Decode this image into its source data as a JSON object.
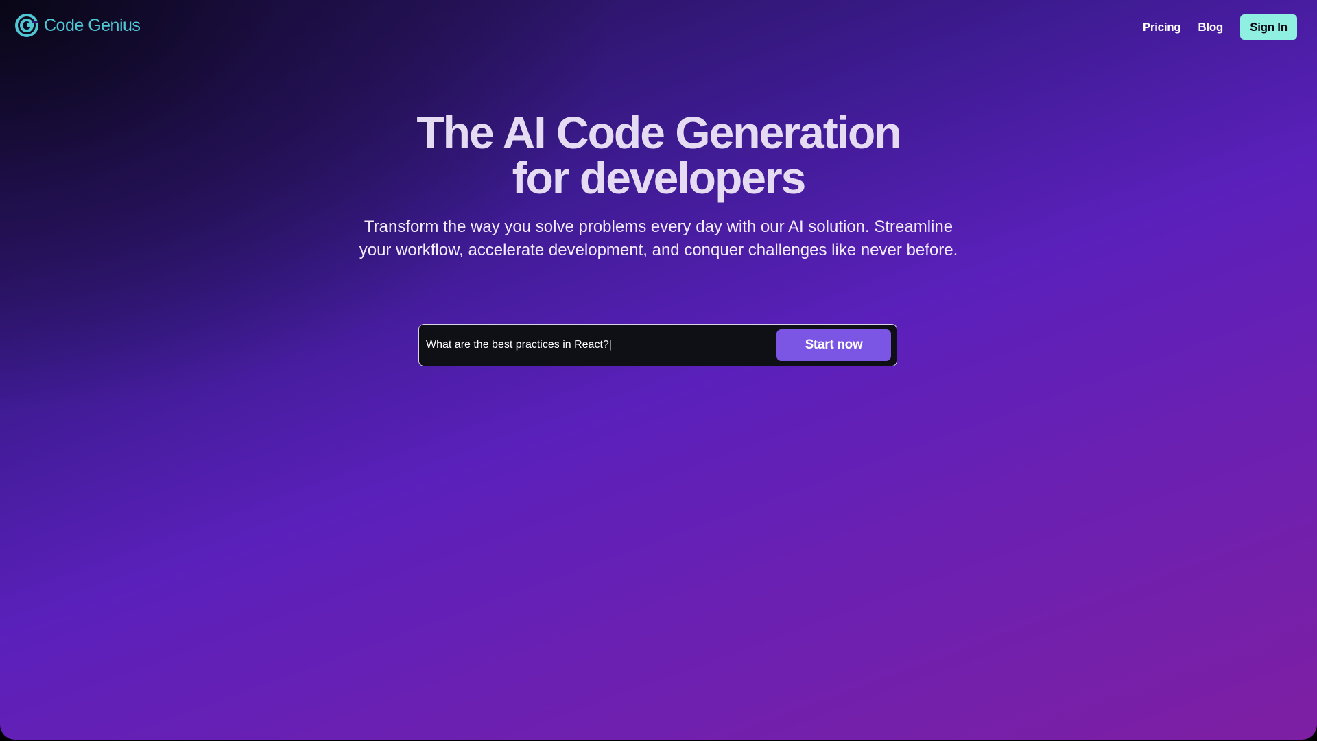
{
  "brand": {
    "name": "Code Genius",
    "logo_icon": "code-genius-logo-icon",
    "color": "#4fc8d4"
  },
  "nav": {
    "links": [
      {
        "label": "Pricing"
      },
      {
        "label": "Blog"
      }
    ],
    "signin_label": "Sign In",
    "signin_color": "#8ff0e2"
  },
  "hero": {
    "title_line1": "The AI Code Generation",
    "title_line2": "for developers",
    "subtitle": "Transform the way you solve problems every day with our AI solution. Streamline your workflow, accelerate development, and conquer challenges like never before."
  },
  "prompt": {
    "value": "What are the best practices in React?|",
    "button_label": "Start now",
    "button_color": "#7b55e3"
  }
}
